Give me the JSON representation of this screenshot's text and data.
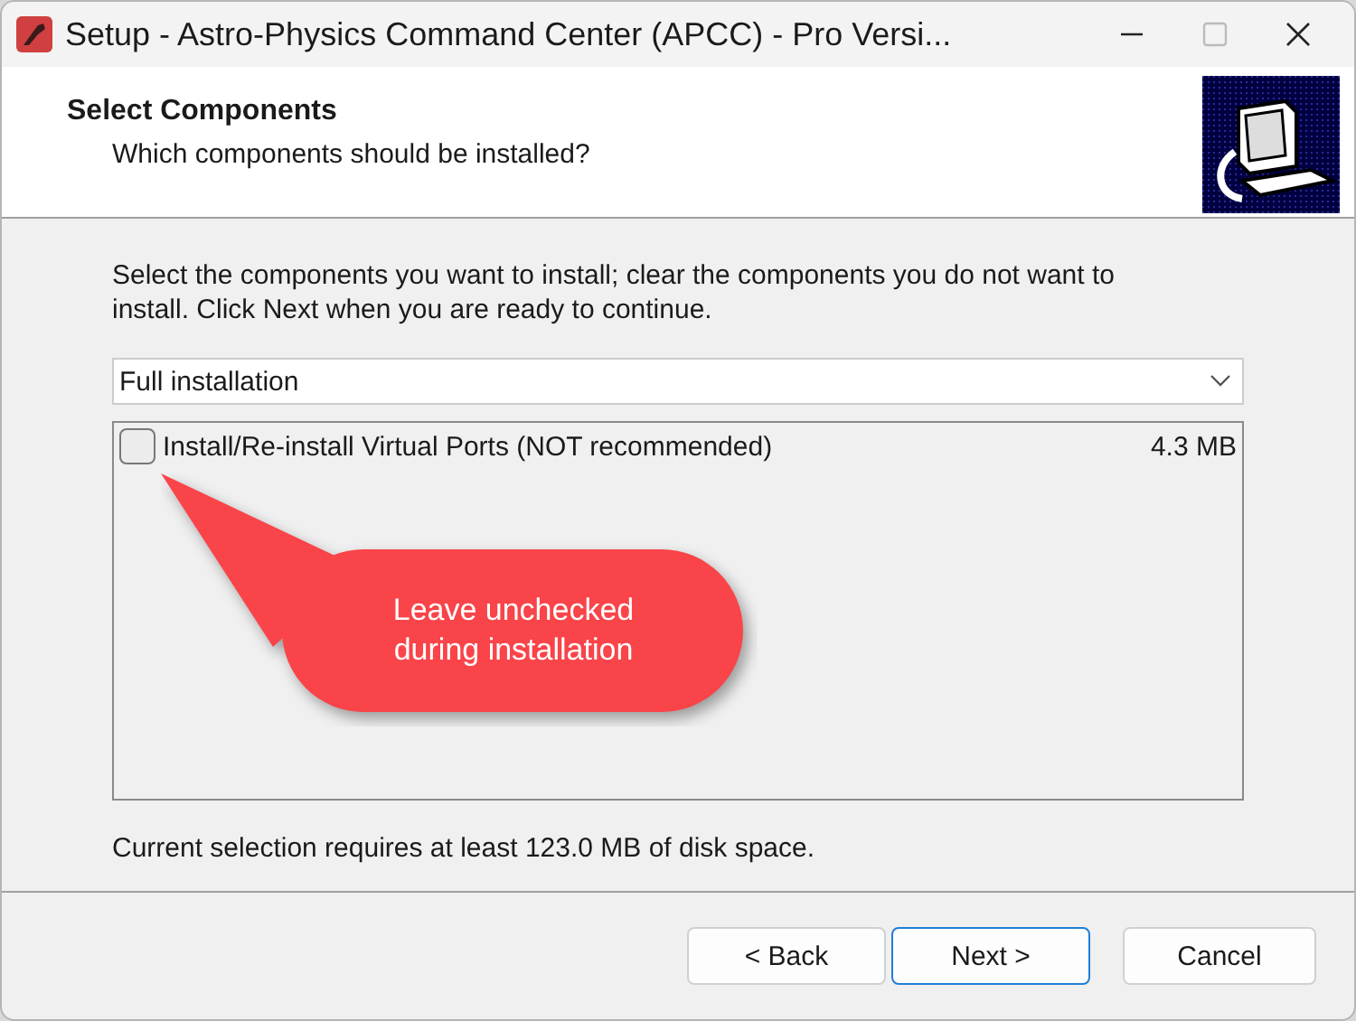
{
  "window": {
    "title": "Setup - Astro-Physics Command Center (APCC) - Pro Versi..."
  },
  "header": {
    "title": "Select Components",
    "subtitle": "Which components should be installed?"
  },
  "instructions": "Select the components you want to install; clear the components you do not want to install. Click Next when you are ready to continue.",
  "setup_type": {
    "value": "Full installation"
  },
  "components": [
    {
      "label": "Install/Re-install Virtual Ports (NOT recommended)",
      "size": "4.3 MB",
      "checked": false
    }
  ],
  "callout": {
    "text": "Leave unchecked during installation"
  },
  "disk_space": "Current selection requires at least 123.0 MB of disk space.",
  "buttons": [
    {
      "label": "< Back",
      "default": false
    },
    {
      "label": "Next >",
      "default": true
    },
    {
      "label": "Cancel",
      "default": false
    }
  ]
}
